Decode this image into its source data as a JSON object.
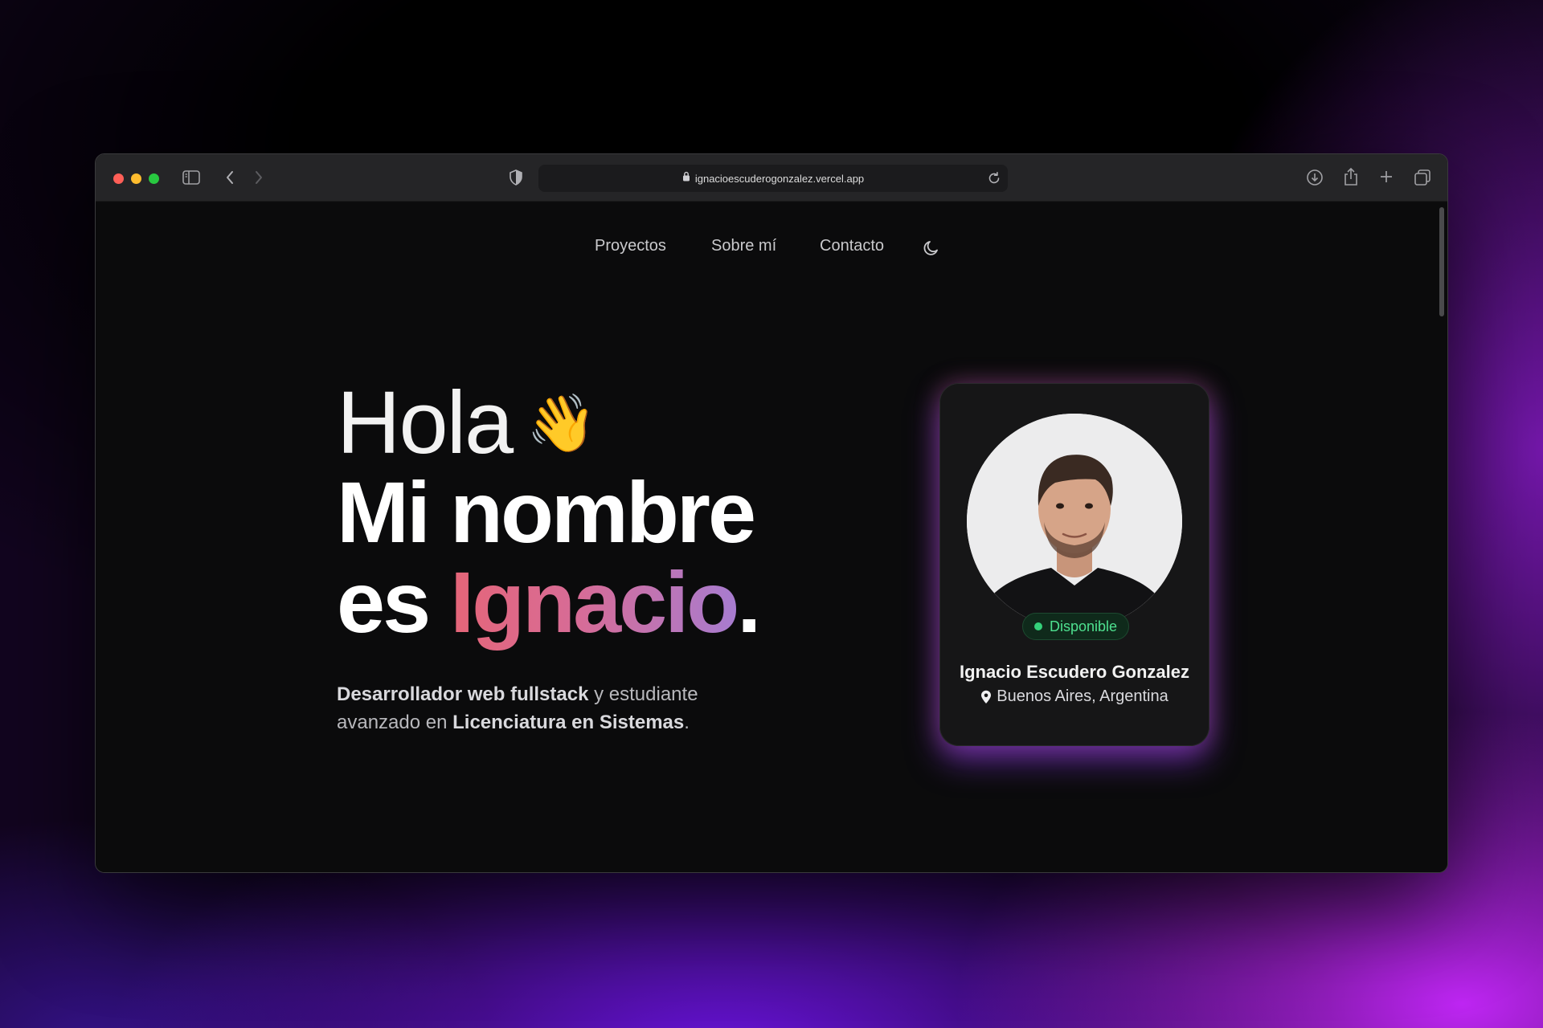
{
  "browser": {
    "url": "ignacioescuderogonzalez.vercel.app"
  },
  "nav": {
    "items": [
      "Proyectos",
      "Sobre mí",
      "Contacto"
    ]
  },
  "hero": {
    "greeting": "Hola",
    "wave_emoji": "👋",
    "line1": "Mi nombre",
    "line2_prefix": "es ",
    "name": "Ignacio",
    "period": ".",
    "desc_bold1": "Desarrollador web fullstack",
    "desc_text1": " y estudiante avanzado en ",
    "desc_bold2": "Licenciatura en Sistemas",
    "desc_text2": "."
  },
  "profile_card": {
    "status": "Disponible",
    "full_name": "Ignacio Escudero Gonzalez",
    "location": "Buenos Aires, Argentina"
  },
  "colors": {
    "accent_gradient_start": "#e56578",
    "accent_gradient_end": "#a77cd0",
    "status_green": "#34d17a"
  }
}
